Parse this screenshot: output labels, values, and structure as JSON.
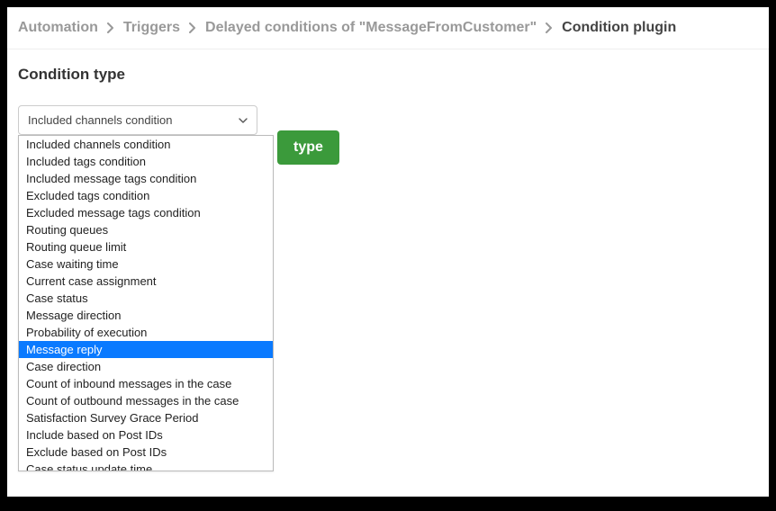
{
  "breadcrumb": {
    "items": [
      {
        "label": "Automation"
      },
      {
        "label": "Triggers"
      },
      {
        "label": "Delayed conditions of \"MessageFromCustomer\""
      },
      {
        "label": "Condition plugin"
      }
    ]
  },
  "section": {
    "title": "Condition type"
  },
  "select": {
    "current": "Included channels condition",
    "options": [
      "Included channels condition",
      "Included tags condition",
      "Included message tags condition",
      "Excluded tags condition",
      "Excluded message tags condition",
      "Routing queues",
      "Routing queue limit",
      "Case waiting time",
      "Current case assignment",
      "Case status",
      "Message direction",
      "Probability of execution",
      "Message reply",
      "Case direction",
      "Count of inbound messages in the case",
      "Count of outbound messages in the case",
      "Satisfaction Survey Grace Period",
      "Include based on Post IDs",
      "Exclude based on Post IDs",
      "Case status update time"
    ],
    "highlighted_index": 12
  },
  "button": {
    "label": "type"
  }
}
